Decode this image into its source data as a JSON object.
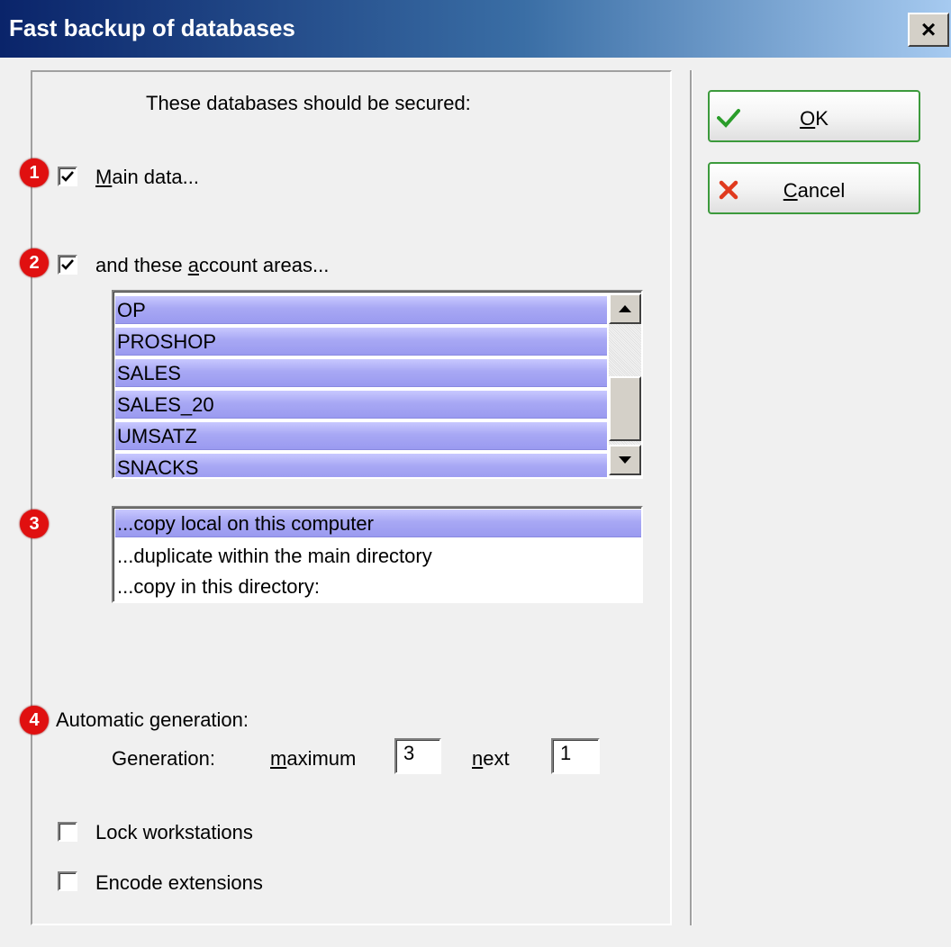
{
  "window": {
    "title": "Fast backup of databases",
    "close_label": "×"
  },
  "heading": "These databases should be secured:",
  "badges": [
    "1",
    "2",
    "3",
    "4"
  ],
  "main_data": {
    "label_pre": "",
    "label_ul": "M",
    "label_post": "ain data...",
    "checked": true
  },
  "account_areas": {
    "label_pre": "and these ",
    "label_ul": "a",
    "label_post": "ccount areas...",
    "checked": true,
    "items": [
      "OP",
      "PROSHOP",
      "SALES",
      "SALES_20",
      "UMSATZ",
      "SNACKS"
    ]
  },
  "copy_options": {
    "items": [
      "...copy local on this computer",
      "...duplicate within the main directory",
      "...copy in this directory:"
    ],
    "selected_index": 0
  },
  "generation": {
    "title": "Automatic generation:",
    "label": "Generation:",
    "max_label_ul": "m",
    "max_label_post": "aximum",
    "max_value": "3",
    "next_label_ul": "n",
    "next_label_post": "ext",
    "next_value": "1"
  },
  "lock_workstations": {
    "label": "Lock workstations",
    "checked": false
  },
  "encode_extensions": {
    "label": "Encode extensions",
    "checked": false
  },
  "buttons": {
    "ok": {
      "label_ul": "O",
      "label_post": "K",
      "icon": "check-icon",
      "icon_color": "#2a9d2a"
    },
    "cancel": {
      "label_ul": "C",
      "label_post": "ancel",
      "icon": "x-icon",
      "icon_color": "#e03a1e"
    }
  },
  "colors": {
    "title_bar_start": "#0a246a",
    "title_bar_end": "#a6caf0",
    "selection": "#a8a8f4",
    "badge": "#e01010"
  }
}
